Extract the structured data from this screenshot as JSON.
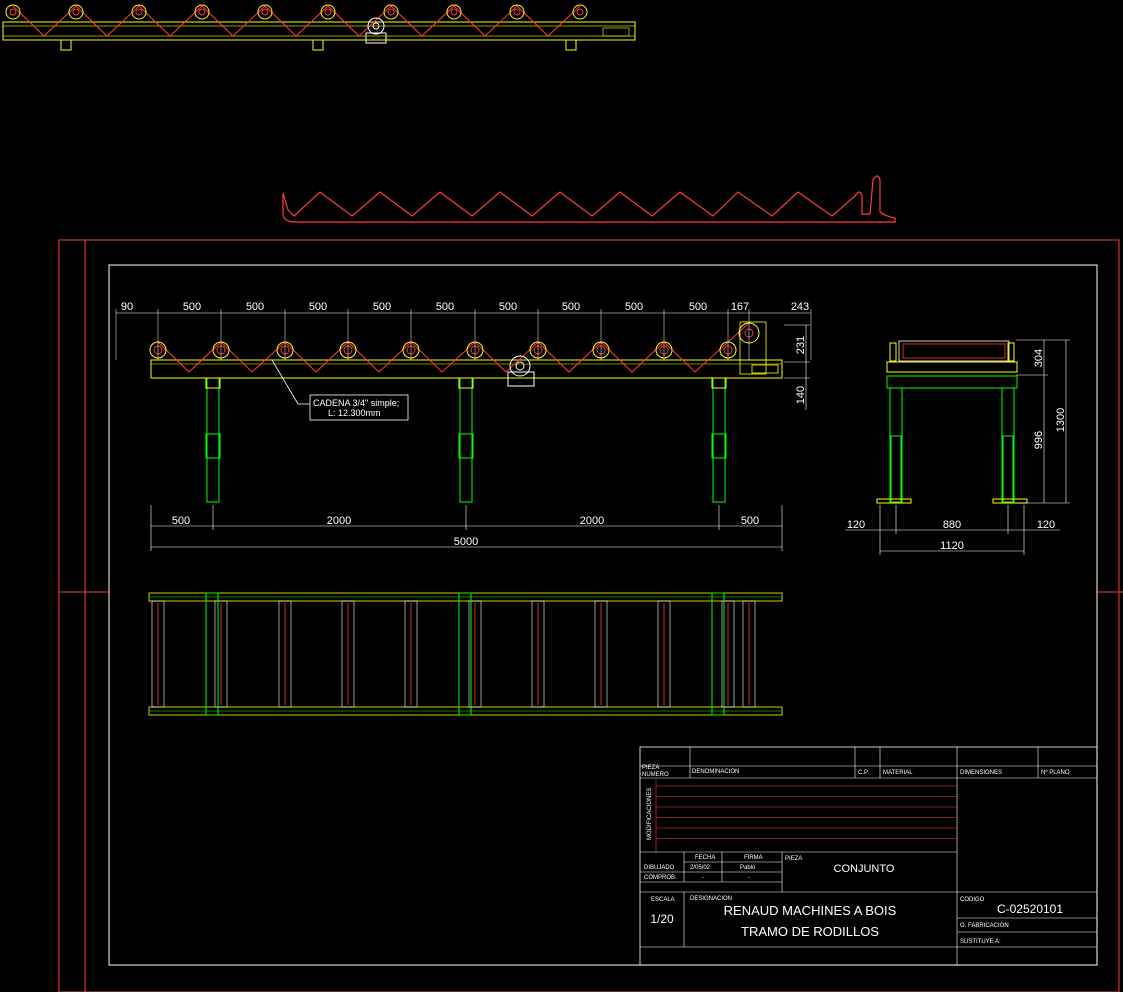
{
  "colors": {
    "background": "#000000",
    "frame": "#ff3a3a",
    "sheet": "#ffffe0",
    "structure": "#ffff00",
    "legs": "#00ff00",
    "chain": "#ff3a3a",
    "dimension": "#ffffff",
    "titleblock_red": "#ff3a3a"
  },
  "dimensions": {
    "top_pitch": [
      "90",
      "500",
      "500",
      "500",
      "500",
      "500",
      "500",
      "500",
      "500",
      "500",
      "167",
      "243"
    ],
    "right_vertical": [
      "231",
      "140"
    ],
    "bottom_spans": [
      "500",
      "2000",
      "2000",
      "500"
    ],
    "overall_length": "5000",
    "side_heights": [
      "304",
      "996",
      "1300"
    ],
    "side_widths": [
      "120",
      "880",
      "120"
    ],
    "side_overall": "1120"
  },
  "callout": {
    "line1": "CADENA 3/4\" simple;",
    "line2": "L: 12.300mm"
  },
  "titleblock": {
    "h_pieza_numero_1": "PIEZA",
    "h_pieza_numero_2": "NUMERO",
    "h_denominacion": "DENOMINACION",
    "h_cp": "C.P.",
    "h_material": "MATERIAL",
    "h_dimensiones": "DIMENSIONES",
    "h_plano": "Nº PLANO",
    "modificaciones": "MODIFICACIONES",
    "h_fecha": "FECHA",
    "h_firma": "FIRMA",
    "h_pieza": "PIEZA",
    "dibujado": "DIBUJADO",
    "comprob": "COMPROB.",
    "fecha_value": "2/05/02",
    "firma_value": "Pablo",
    "dash1": "-",
    "dash2": "-",
    "pieza_value": "CONJUNTO",
    "h_escala": "ESCALA",
    "escala_value": "1/20",
    "h_designacion": "DESIGNACION",
    "designacion_line1": "RENAUD MACHINES A BOIS",
    "designacion_line2": "TRAMO DE RODILLOS",
    "h_codigo": "CODIGO",
    "codigo_value": "C-02520101",
    "o_fabricacion": "O. FABRICACION",
    "sustituye": "SUSTITUYE A:"
  }
}
